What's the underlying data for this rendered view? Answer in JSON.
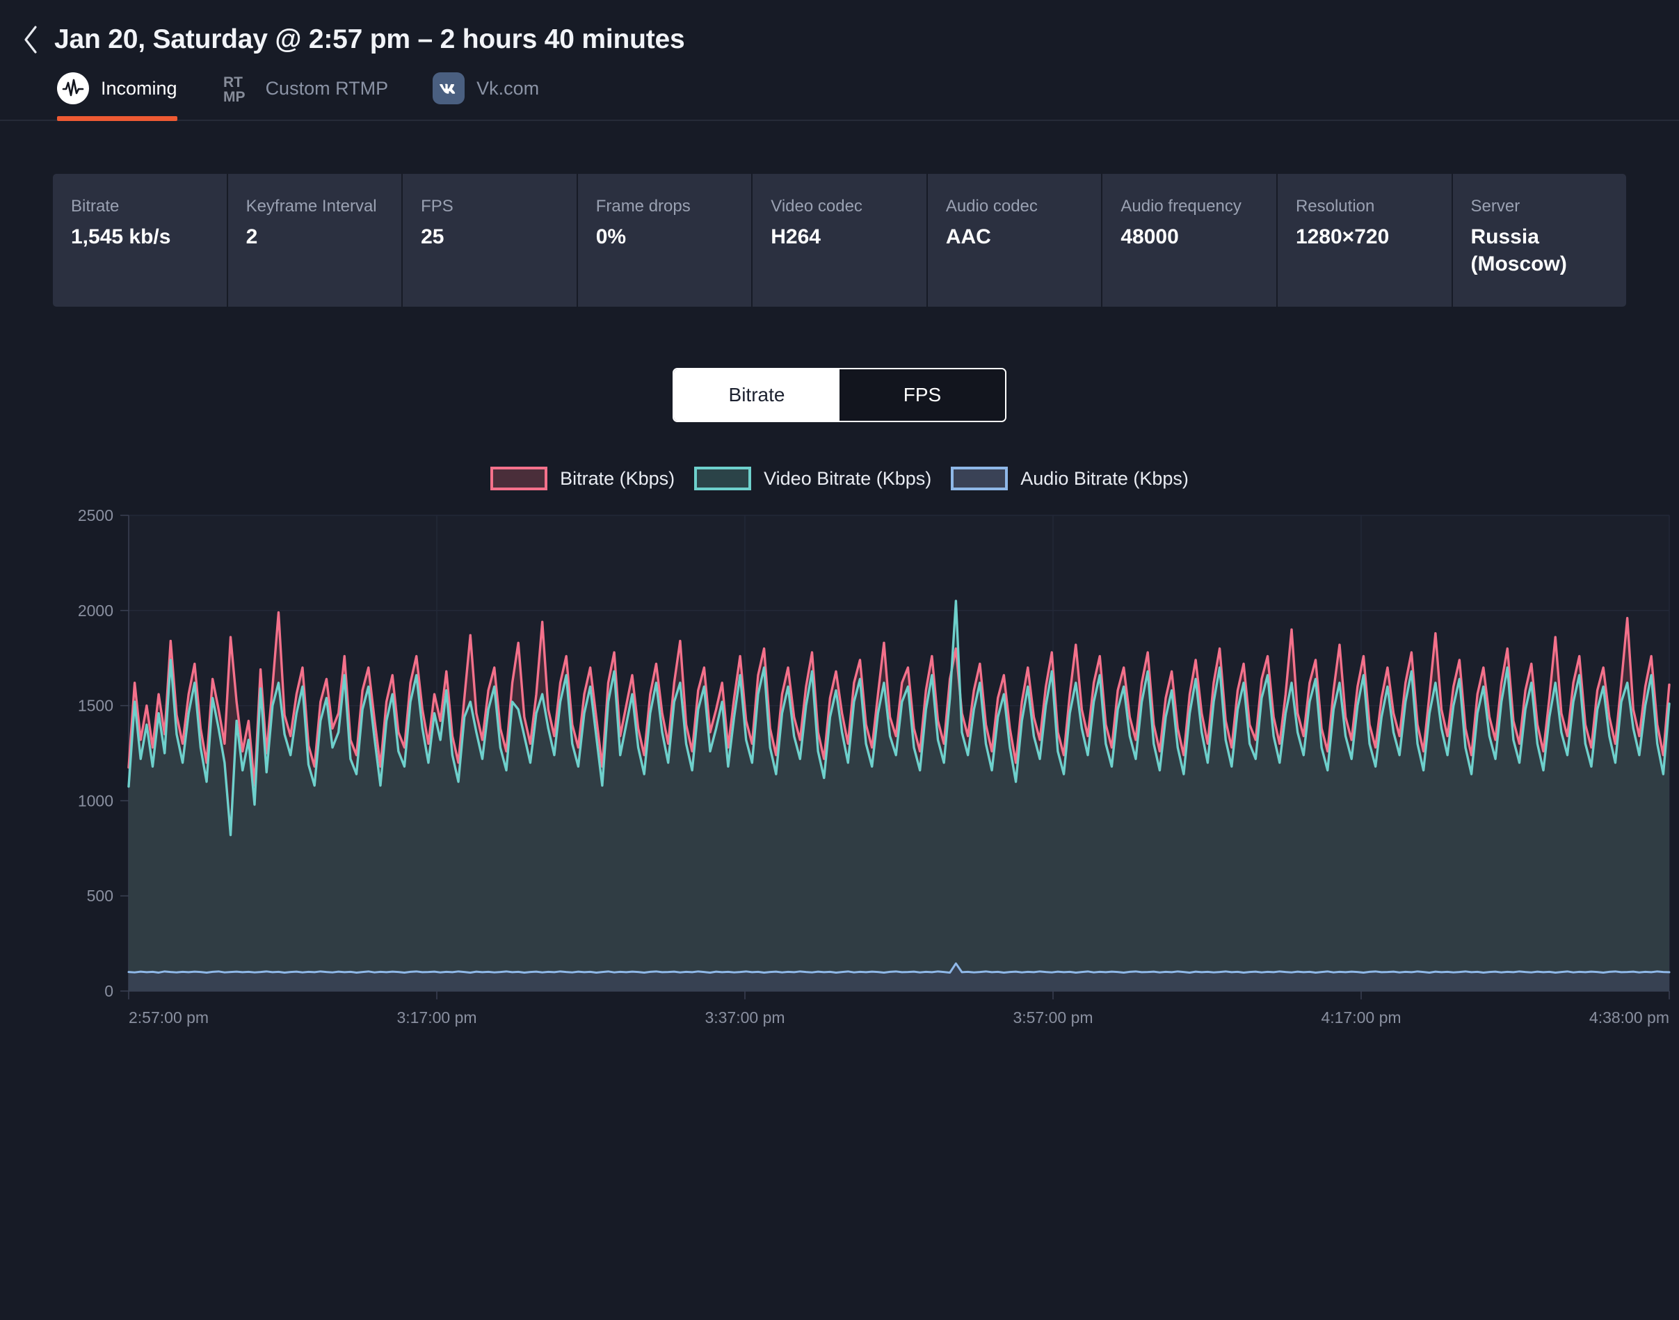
{
  "header": {
    "back_icon": "chevron-left-icon",
    "title": "Jan 20, Saturday @ 2:57 pm – 2 hours 40 minutes"
  },
  "tabs": [
    {
      "label": "Incoming",
      "icon": "incoming-waveform-icon",
      "active": true
    },
    {
      "label": "Custom RTMP",
      "icon": "rtmp-icon",
      "active": false
    },
    {
      "label": "Vk.com",
      "icon": "vk-icon",
      "active": false
    }
  ],
  "stats": [
    {
      "label": "Bitrate",
      "value": "1,545 kb/s"
    },
    {
      "label": "Keyframe Interval",
      "value": "2"
    },
    {
      "label": "FPS",
      "value": "25"
    },
    {
      "label": "Frame drops",
      "value": "0%"
    },
    {
      "label": "Video codec",
      "value": "H264"
    },
    {
      "label": "Audio codec",
      "value": "AAC"
    },
    {
      "label": "Audio frequency",
      "value": "48000"
    },
    {
      "label": "Resolution",
      "value": "1280×720"
    },
    {
      "label": "Server",
      "value": "Russia (Moscow)"
    }
  ],
  "toggle": {
    "options": [
      {
        "label": "Bitrate",
        "active": true
      },
      {
        "label": "FPS",
        "active": false
      }
    ]
  },
  "colors": {
    "accent": "#ee5a33",
    "background": "#171b26",
    "card": "#2b3040",
    "bitrate_line": "#f4718b",
    "bitrate_fill": "#4a2e3a",
    "video_line": "#6ed0cc",
    "video_fill": "#2b4348",
    "audio_line": "#8fb8e8",
    "audio_fill": "#3a4256",
    "vk_brand": "#4a5f80"
  },
  "chart_data": {
    "type": "area",
    "title": "",
    "xlabel": "",
    "ylabel": "",
    "ylim": [
      0,
      2500
    ],
    "yticks": [
      0,
      500,
      1000,
      1500,
      2000,
      2500
    ],
    "ytick_labels": [
      "0",
      "500",
      "1000",
      "1500",
      "2000",
      "2500"
    ],
    "grid": true,
    "legend_position": "top-center",
    "xtick_labels": [
      "2:57:00 pm",
      "3:17:00 pm",
      "3:37:00 pm",
      "3:57:00 pm",
      "4:17:00 pm",
      "4:38:00 pm"
    ],
    "xtick_positions": [
      0,
      0.2,
      0.4,
      0.6,
      0.8,
      1.0
    ],
    "series": [
      {
        "name": "Bitrate (Kbps)",
        "line_color": "#f4718b",
        "fill_color": "#4a2e3a",
        "values": [
          1175,
          1620,
          1320,
          1500,
          1280,
          1560,
          1350,
          1840,
          1450,
          1300,
          1560,
          1720,
          1380,
          1200,
          1640,
          1480,
          1300,
          1860,
          1520,
          1260,
          1420,
          1080,
          1690,
          1250,
          1600,
          1990,
          1450,
          1340,
          1560,
          1700,
          1290,
          1180,
          1520,
          1640,
          1380,
          1460,
          1760,
          1320,
          1240,
          1580,
          1700,
          1430,
          1180,
          1520,
          1660,
          1360,
          1280,
          1620,
          1760,
          1480,
          1300,
          1560,
          1420,
          1680,
          1340,
          1200,
          1540,
          1870,
          1460,
          1320,
          1580,
          1700,
          1380,
          1260,
          1620,
          1830,
          1440,
          1300,
          1560,
          1940,
          1480,
          1340,
          1620,
          1760,
          1400,
          1280,
          1560,
          1700,
          1440,
          1180,
          1620,
          1780,
          1340,
          1500,
          1660,
          1380,
          1240,
          1560,
          1720,
          1460,
          1300,
          1620,
          1840,
          1400,
          1260,
          1580,
          1700,
          1360,
          1480,
          1620,
          1280,
          1540,
          1760,
          1420,
          1300,
          1660,
          1800,
          1380,
          1240,
          1560,
          1700,
          1440,
          1320,
          1600,
          1780,
          1360,
          1220,
          1540,
          1680,
          1460,
          1300,
          1620,
          1740,
          1400,
          1280,
          1560,
          1830,
          1440,
          1340,
          1620,
          1700,
          1380,
          1260,
          1580,
          1760,
          1420,
          1300,
          1640,
          1800,
          1460,
          1340,
          1580,
          1720,
          1400,
          1260,
          1540,
          1660,
          1380,
          1200,
          1520,
          1700,
          1440,
          1320,
          1600,
          1780,
          1360,
          1240,
          1560,
          1820,
          1480,
          1340,
          1620,
          1760,
          1400,
          1280,
          1580,
          1700,
          1440,
          1320,
          1620,
          1780,
          1400,
          1260,
          1540,
          1680,
          1380,
          1240,
          1560,
          1740,
          1460,
          1300,
          1620,
          1800,
          1420,
          1280,
          1580,
          1720,
          1400,
          1320,
          1640,
          1760,
          1440,
          1300,
          1560,
          1900,
          1460,
          1340,
          1620,
          1740,
          1380,
          1260,
          1580,
          1820,
          1440,
          1320,
          1600,
          1760,
          1400,
          1280,
          1540,
          1700,
          1460,
          1340,
          1620,
          1780,
          1400,
          1260,
          1560,
          1880,
          1480,
          1340,
          1600,
          1740,
          1380,
          1240,
          1560,
          1700,
          1440,
          1320,
          1620,
          1800,
          1420,
          1300,
          1580,
          1720,
          1400,
          1260,
          1540,
          1860,
          1460,
          1340,
          1620,
          1760,
          1400,
          1280,
          1580,
          1700,
          1440,
          1300,
          1620,
          1960,
          1480,
          1340,
          1600,
          1760,
          1400,
          1240,
          1610
        ],
        "min": 1080,
        "max": 1990,
        "average": 1545
      },
      {
        "name": "Video Bitrate (Kbps)",
        "line_color": "#6ed0cc",
        "fill_color": "#2b4348",
        "values": [
          1075,
          1520,
          1220,
          1400,
          1180,
          1460,
          1250,
          1740,
          1350,
          1200,
          1460,
          1620,
          1280,
          1100,
          1540,
          1380,
          1200,
          820,
          1420,
          1160,
          1320,
          980,
          1590,
          1150,
          1500,
          1620,
          1350,
          1240,
          1460,
          1600,
          1190,
          1080,
          1420,
          1540,
          1280,
          1360,
          1660,
          1220,
          1140,
          1480,
          1600,
          1330,
          1080,
          1420,
          1560,
          1260,
          1180,
          1520,
          1660,
          1380,
          1200,
          1460,
          1320,
          1580,
          1240,
          1100,
          1440,
          1520,
          1360,
          1220,
          1480,
          1600,
          1280,
          1160,
          1520,
          1480,
          1340,
          1200,
          1460,
          1560,
          1380,
          1240,
          1520,
          1660,
          1300,
          1180,
          1460,
          1600,
          1340,
          1080,
          1520,
          1680,
          1240,
          1400,
          1560,
          1280,
          1140,
          1460,
          1620,
          1360,
          1200,
          1520,
          1620,
          1300,
          1160,
          1480,
          1600,
          1260,
          1380,
          1520,
          1180,
          1440,
          1660,
          1320,
          1200,
          1560,
          1700,
          1280,
          1140,
          1460,
          1600,
          1340,
          1220,
          1500,
          1680,
          1260,
          1120,
          1440,
          1580,
          1360,
          1200,
          1520,
          1640,
          1300,
          1180,
          1460,
          1620,
          1340,
          1240,
          1520,
          1600,
          1280,
          1160,
          1480,
          1660,
          1320,
          1200,
          1540,
          2050,
          1360,
          1240,
          1480,
          1620,
          1300,
          1160,
          1440,
          1560,
          1280,
          1100,
          1420,
          1600,
          1340,
          1220,
          1500,
          1680,
          1260,
          1140,
          1460,
          1620,
          1380,
          1240,
          1520,
          1660,
          1300,
          1180,
          1480,
          1600,
          1340,
          1220,
          1520,
          1680,
          1300,
          1160,
          1440,
          1580,
          1280,
          1140,
          1460,
          1640,
          1360,
          1200,
          1520,
          1700,
          1320,
          1180,
          1480,
          1620,
          1300,
          1220,
          1540,
          1660,
          1340,
          1200,
          1460,
          1620,
          1360,
          1240,
          1520,
          1640,
          1280,
          1160,
          1480,
          1620,
          1340,
          1220,
          1500,
          1660,
          1300,
          1180,
          1440,
          1600,
          1360,
          1240,
          1520,
          1680,
          1300,
          1160,
          1460,
          1620,
          1380,
          1240,
          1500,
          1640,
          1280,
          1140,
          1460,
          1600,
          1340,
          1220,
          1520,
          1700,
          1320,
          1200,
          1480,
          1620,
          1300,
          1160,
          1440,
          1620,
          1360,
          1240,
          1520,
          1660,
          1300,
          1180,
          1480,
          1600,
          1340,
          1200,
          1520,
          1620,
          1380,
          1240,
          1500,
          1660,
          1300,
          1140,
          1510
        ],
        "min": 820,
        "max": 2050
      },
      {
        "name": "Audio Bitrate (Kbps)",
        "line_color": "#8fb8e8",
        "fill_color": "#3a4256",
        "values": [
          100,
          98,
          102,
          99,
          101,
          97,
          103,
          100,
          98,
          101,
          99,
          102,
          100,
          97,
          101,
          103,
          98,
          100,
          102,
          99,
          101,
          98,
          100,
          103,
          99,
          101,
          97,
          100,
          102,
          98,
          101,
          99,
          103,
          100,
          98,
          102,
          99,
          101,
          97,
          100,
          103,
          98,
          101,
          99,
          102,
          100,
          97,
          101,
          103,
          99,
          100,
          102,
          98,
          101,
          99,
          103,
          100,
          97,
          102,
          99,
          101,
          98,
          100,
          103,
          99,
          101,
          97,
          100,
          102,
          98,
          101,
          99,
          103,
          100,
          98,
          102,
          99,
          101,
          97,
          100,
          103,
          98,
          101,
          99,
          102,
          100,
          97,
          101,
          103,
          99,
          100,
          102,
          98,
          101,
          99,
          103,
          100,
          97,
          102,
          99,
          101,
          98,
          100,
          103,
          99,
          101,
          97,
          100,
          102,
          98,
          101,
          99,
          103,
          100,
          98,
          102,
          99,
          101,
          97,
          100,
          103,
          98,
          101,
          99,
          102,
          100,
          97,
          101,
          103,
          99,
          100,
          102,
          98,
          101,
          99,
          103,
          100,
          97,
          145,
          99,
          101,
          98,
          100,
          103,
          99,
          101,
          97,
          100,
          102,
          98,
          101,
          99,
          103,
          100,
          98,
          102,
          99,
          101,
          97,
          100,
          103,
          98,
          101,
          99,
          102,
          100,
          97,
          101,
          103,
          99,
          100,
          102,
          98,
          101,
          99,
          103,
          100,
          97,
          102,
          99,
          101,
          98,
          100,
          103,
          99,
          101,
          97,
          100,
          102,
          98,
          101,
          99,
          103,
          100,
          98,
          102,
          99,
          101,
          97,
          100,
          103,
          98,
          101,
          99,
          102,
          100,
          97,
          101,
          103,
          99,
          100,
          102,
          98,
          101,
          99,
          103,
          100,
          97,
          102,
          99,
          101,
          98,
          100,
          103,
          99,
          101,
          97,
          100,
          102,
          98,
          101,
          99,
          103,
          100,
          98,
          102,
          99,
          101,
          97,
          100,
          103,
          98,
          101,
          99,
          102,
          100,
          97,
          101,
          103,
          99,
          100,
          102,
          98,
          101,
          99,
          103,
          100,
          99
        ],
        "min": 97,
        "max": 145
      }
    ]
  }
}
